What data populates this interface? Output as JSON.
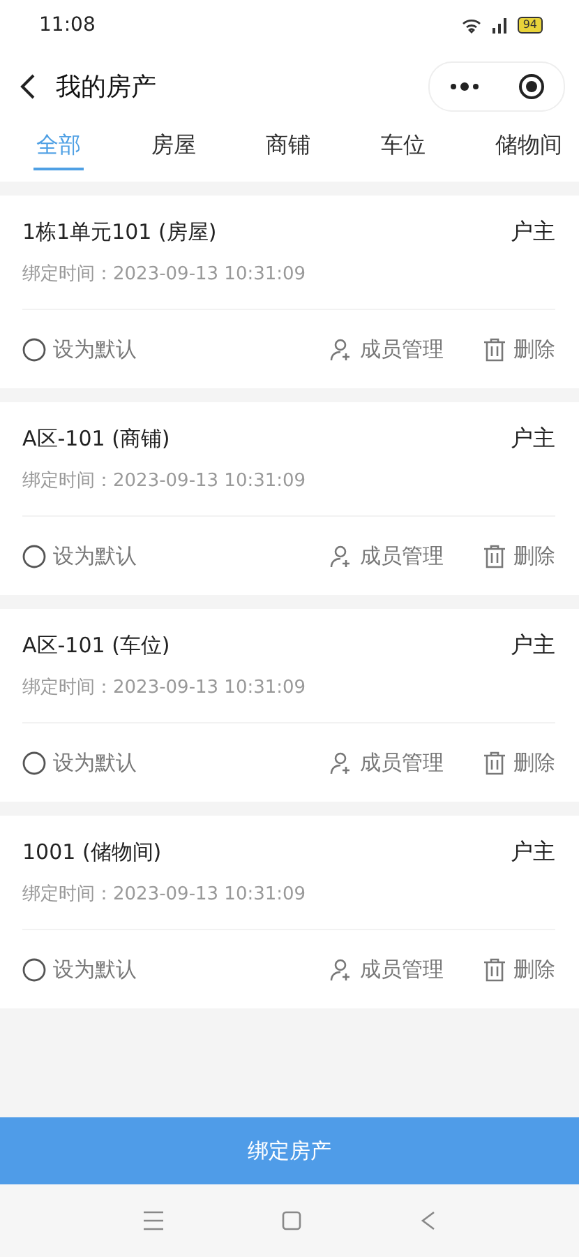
{
  "status_bar": {
    "time": "11:08",
    "battery": "94"
  },
  "header": {
    "title": "我的房产"
  },
  "tabs": [
    {
      "label": "全部",
      "selected": true
    },
    {
      "label": "房屋",
      "selected": false
    },
    {
      "label": "商铺",
      "selected": false
    },
    {
      "label": "车位",
      "selected": false
    },
    {
      "label": "储物间",
      "selected": false
    }
  ],
  "properties": [
    {
      "name": "1栋1单元101 (房屋)",
      "role": "户主",
      "bind_time": "绑定时间：2023-09-13 10:31:09",
      "default_label": "设为默认",
      "checked": false,
      "members_label": "成员管理",
      "delete_label": "删除"
    },
    {
      "name": "A区-101 (商铺)",
      "role": "户主",
      "bind_time": "绑定时间：2023-09-13 10:31:09",
      "default_label": "设为默认",
      "checked": false,
      "members_label": "成员管理",
      "delete_label": "删除"
    },
    {
      "name": "A区-101 (车位)",
      "role": "户主",
      "bind_time": "绑定时间：2023-09-13 10:31:09",
      "default_label": "设为默认",
      "checked": false,
      "members_label": "成员管理",
      "delete_label": "删除"
    },
    {
      "name": "1001 (储物间)",
      "role": "户主",
      "bind_time": "绑定时间：2023-09-13 10:31:09",
      "default_label": "设为默认",
      "checked": false,
      "members_label": "成员管理",
      "delete_label": "删除"
    }
  ],
  "bind_button": "绑定房产"
}
